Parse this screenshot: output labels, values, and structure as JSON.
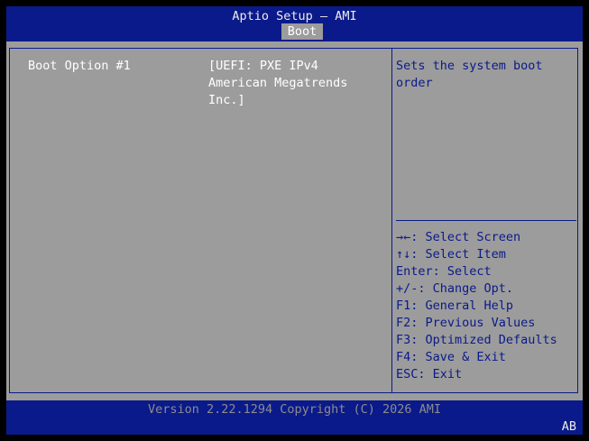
{
  "header": {
    "title": "Aptio Setup – AMI",
    "active_tab": "Boot"
  },
  "settings": {
    "boot_option_label": "Boot Option #1",
    "boot_option_value": "[UEFI: PXE IPv4\nAmerican Megatrends\nInc.]"
  },
  "help": {
    "description": "Sets the system boot\norder",
    "keys": [
      "→←: Select Screen",
      "↑↓: Select Item",
      "Enter: Select",
      "+/-: Change Opt.",
      "F1: General Help",
      "F2: Previous Values",
      "F3: Optimized Defaults",
      "F4: Save & Exit",
      "ESC: Exit"
    ]
  },
  "footer": {
    "version": "Version 2.22.1294 Copyright (C) 2026 AMI",
    "corner": "AB"
  },
  "colors": {
    "background_blue": "#0a1a8a",
    "panel_grey": "#9c9c9c"
  }
}
